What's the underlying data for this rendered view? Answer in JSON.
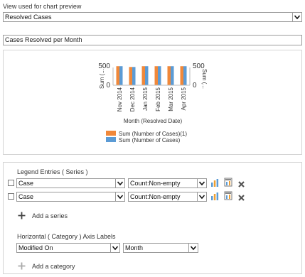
{
  "view_selector": {
    "label": "View used for chart preview",
    "value": "Resolved Cases"
  },
  "chart_title_input": {
    "value": "Cases Resolved per Month"
  },
  "chart_data": {
    "type": "bar",
    "categories": [
      "Nov 2014",
      "Dec 2014",
      "Jan 2015",
      "Feb 2015",
      "Mar 2015",
      "Apr 2015"
    ],
    "series": [
      {
        "name": "Sum (Number of Cases)(1)",
        "values": [
          500,
          480,
          500,
          500,
          500,
          500
        ],
        "color": "#f0883a"
      },
      {
        "name": "Sum (Number of Cases)",
        "values": [
          500,
          480,
          500,
          500,
          500,
          500
        ],
        "color": "#5b9bd5"
      }
    ],
    "xlabel": "Month (Resolved Date)",
    "ylabel_left": "Sum (...",
    "ylabel_right": "Sum (...",
    "yticks": [
      0,
      500
    ],
    "ylim": [
      0,
      560
    ],
    "legend_position": "bottom"
  },
  "series_section": {
    "title": "Legend Entries ( Series )",
    "rows": [
      {
        "field": "Case",
        "aggregate": "Count:Non-empty"
      },
      {
        "field": "Case",
        "aggregate": "Count:Non-empty"
      }
    ],
    "add_label": "Add a series"
  },
  "category_section": {
    "title": "Horizontal ( Category ) Axis Labels",
    "field": "Modified On",
    "grouping": "Month",
    "add_label": "Add a category"
  },
  "icons": {
    "chart_type": "bar-chart-icon",
    "options": "chart-options-icon",
    "delete": "delete-x-icon",
    "add": "plus-icon",
    "dropdown": "chevron-down-icon"
  },
  "colors": {
    "orange": "#f0883a",
    "blue": "#5b9bd5",
    "delete": "#555555"
  }
}
